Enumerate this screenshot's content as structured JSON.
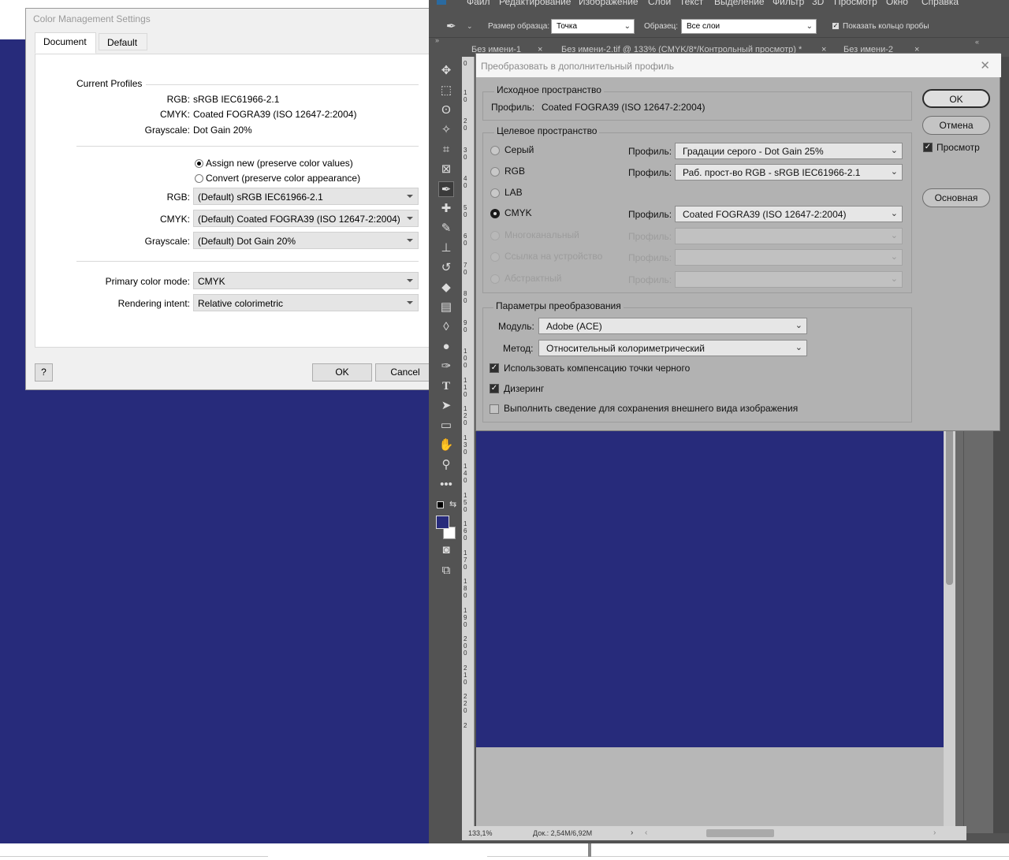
{
  "cms": {
    "title": "Color Management Settings",
    "tabs": [
      {
        "label": "Document"
      },
      {
        "label": "Default"
      }
    ],
    "current_profiles_header": "Current Profiles",
    "current": {
      "rgb_label": "RGB:",
      "rgb_value": "sRGB IEC61966-2.1",
      "cmyk_label": "CMYK:",
      "cmyk_value": "Coated FOGRA39 (ISO 12647-2:2004)",
      "gray_label": "Grayscale:",
      "gray_value": "Dot Gain 20%"
    },
    "radio_assign": "Assign new (preserve color values)",
    "radio_convert": "Convert (preserve color appearance)",
    "rgb_select": "(Default) sRGB IEC61966-2.1",
    "cmyk_select": "(Default) Coated FOGRA39 (ISO 12647-2:2004)",
    "gray_select": "(Default) Dot Gain 20%",
    "primary_label": "Primary color mode:",
    "primary_value": "CMYK",
    "intent_label": "Rendering intent:",
    "intent_value": "Relative colorimetric",
    "help_label": "?",
    "ok_label": "OK",
    "cancel_label": "Cancel"
  },
  "ps": {
    "menu": [
      "Файл",
      "Редактирование",
      "Изображение",
      "Слои",
      "Текст",
      "Выделение",
      "Фильтр",
      "3D",
      "Просмотр",
      "Окно",
      "Справка"
    ],
    "options": {
      "sample_size_label": "Размер образца:",
      "sample_size_value": "Точка",
      "samples_label": "Образец:",
      "samples_value": "Все слои",
      "show_ring_label": "Показать кольцо пробы"
    },
    "tabs": [
      "Без имени-1",
      "Без имени-2.tif @ 133% (CMYK/8*/Контрольный просмотр) *",
      "Без имени-2"
    ],
    "ruler_numbers": [
      "0",
      "1\n0",
      "2\n0",
      "3\n0",
      "4\n0",
      "5\n0",
      "6\n0",
      "7\n0",
      "8\n0",
      "9\n0",
      "1\n0\n0",
      "1\n1\n0",
      "1\n2\n0",
      "1\n3\n0",
      "1\n4\n0",
      "1\n5\n0",
      "1\n6\n0",
      "1\n7\n0",
      "1\n8\n0",
      "1\n9\n0",
      "2\n0\n0",
      "2\n1\n0",
      "2\n2\n0",
      "2"
    ],
    "status": {
      "zoom": "133,1%",
      "doc": "Док.: 2,54M/6,92M"
    },
    "colors": {
      "foreground": "#272b7b",
      "background": "#ffffff",
      "document": "#272b7b"
    }
  },
  "convert": {
    "title": "Преобразовать в дополнительный профиль",
    "source_group": "Исходное пространство",
    "source_profile_label": "Профиль:",
    "source_profile_value": "Coated FOGRA39 (ISO 12647-2:2004)",
    "target_group": "Целевое пространство",
    "profile_label": "Профиль:",
    "targets": [
      {
        "label": "Серый",
        "value": "Градации серого - Dot Gain 25%"
      },
      {
        "label": "RGB",
        "value": "Раб. прост-во RGB - sRGB IEC61966-2.1"
      },
      {
        "label": "LAB",
        "value": ""
      },
      {
        "label": "CMYK",
        "value": "Coated FOGRA39 (ISO 12647-2:2004)"
      },
      {
        "label": "Многоканальный",
        "value": ""
      },
      {
        "label": "Ссылка на устройство",
        "value": ""
      },
      {
        "label": "Абстрактный",
        "value": ""
      }
    ],
    "params_group": "Параметры преобразования",
    "module_label": "Модуль:",
    "module_value": "Adobe (ACE)",
    "method_label": "Метод:",
    "method_value": "Относительный колориметрический",
    "chk_bpc": "Использовать компенсацию точки черного",
    "chk_dither": "Дизеринг",
    "chk_flatten": "Выполнить сведение для сохранения внешнего вида изображения",
    "ok": "OK",
    "cancel": "Отмена",
    "preview": "Просмотр",
    "basic": "Основная"
  }
}
